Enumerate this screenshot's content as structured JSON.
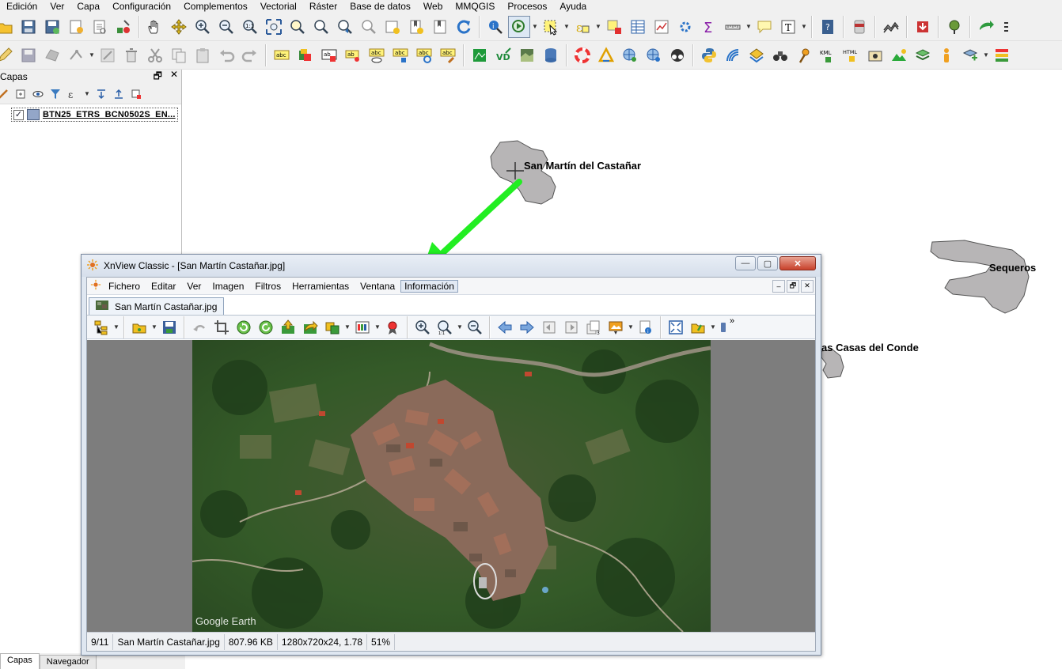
{
  "qgis": {
    "menu": [
      "Edición",
      "Ver",
      "Capa",
      "Configuración",
      "Complementos",
      "Vectorial",
      "Ráster",
      "Base de datos",
      "Web",
      "MMQGIS",
      "Procesos",
      "Ayuda"
    ],
    "layers_panel": {
      "title": "Capas",
      "float_glyph": "🗗",
      "close_glyph": "✕",
      "layer_name": "BTN25_ETRS_BCN0502S_EN...",
      "checked_glyph": "✓"
    },
    "bottom_tabs": [
      "Capas",
      "Navegador"
    ],
    "map_labels": {
      "castanar": "San Martín del Castañar",
      "sequeros": "Sequeros",
      "casas": "as Casas del Conde"
    },
    "colors": {
      "polygon_fill": "#b7b5b6",
      "arrow": "#22ee22",
      "layer_swatch": "#93a6c8"
    }
  },
  "xnview": {
    "title": "XnView Classic - [San Martín Castañar.jpg]",
    "menu": [
      "Fichero",
      "Editar",
      "Ver",
      "Imagen",
      "Filtros",
      "Herramientas",
      "Ventana",
      "Información"
    ],
    "tab": "San Martín Castañar.jpg",
    "watermark": "Google Earth",
    "status": [
      "9/11",
      "San Martín Castañar.jpg",
      "807.96 KB",
      "1280x720x24, 1.78",
      "51%"
    ],
    "window_buttons": {
      "minimize": "—",
      "maximize": "▢",
      "close": "✕"
    },
    "mdi_buttons": {
      "minimize": "–",
      "restore": "🗗",
      "close": "✕"
    },
    "more_glyph": "»"
  }
}
